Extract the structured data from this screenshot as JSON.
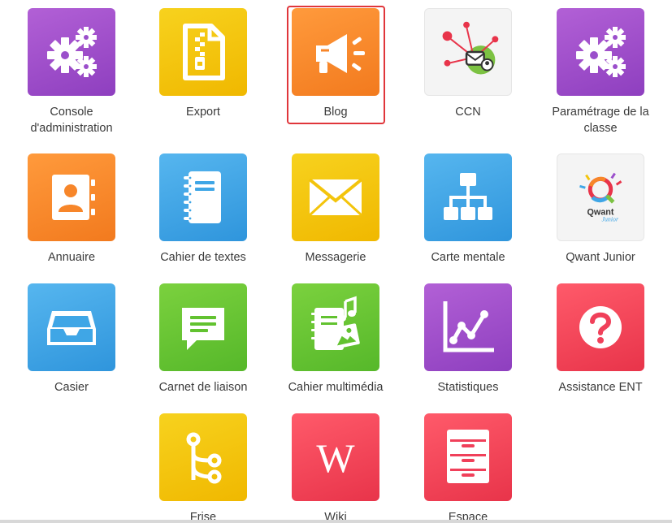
{
  "apps": [
    {
      "label": "Console\nd'administration",
      "icon": "gears-icon",
      "color": "#9b4fcb"
    },
    {
      "label": "Export",
      "icon": "zip-file-icon",
      "color": "#f3c40c"
    },
    {
      "label": "Blog",
      "icon": "megaphone-icon",
      "color": "#f7862a",
      "selected": true
    },
    {
      "label": "CCN",
      "icon": "ccn-network-icon",
      "color": "#f4f4f4"
    },
    {
      "label": "Paramétrage de la\nclasse",
      "icon": "gears-icon",
      "color": "#9b4fcb"
    },
    {
      "label": "Annuaire",
      "icon": "address-book-icon",
      "color": "#f7862a"
    },
    {
      "label": "Cahier de textes",
      "icon": "notebook-icon",
      "color": "#3fa6e6"
    },
    {
      "label": "Messagerie",
      "icon": "envelope-icon",
      "color": "#f3c40c"
    },
    {
      "label": "Carte mentale",
      "icon": "sitemap-icon",
      "color": "#3fa6e6"
    },
    {
      "label": "Qwant Junior",
      "icon": "qwant-logo-icon",
      "color": "#f4f4f4",
      "logo_text": "Qwant",
      "logo_subtext": "Junior"
    },
    {
      "label": "Casier",
      "icon": "inbox-tray-icon",
      "color": "#3fa6e6"
    },
    {
      "label": "Carnet de liaison",
      "icon": "speech-bubble-icon",
      "color": "#62c230"
    },
    {
      "label": "Cahier multimédia",
      "icon": "multimedia-notebook-icon",
      "color": "#62c230"
    },
    {
      "label": "Statistiques",
      "icon": "line-chart-icon",
      "color": "#9b4fcb"
    },
    {
      "label": "Assistance ENT",
      "icon": "question-icon",
      "color": "#f0405a"
    },
    {
      "label": "Frise",
      "icon": "timeline-branch-icon",
      "color": "#f3c40c"
    },
    {
      "label": "Wiki",
      "icon": "wikipedia-icon",
      "color": "#f0405a",
      "glyph": "W"
    },
    {
      "label": "Espace",
      "icon": "drawers-icon",
      "color": "#f0405a"
    }
  ]
}
